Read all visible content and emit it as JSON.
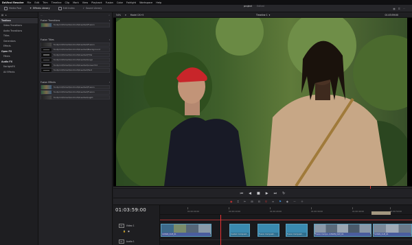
{
  "menubar": {
    "brand": "DaVinci Resolve",
    "items": [
      "File",
      "Edit",
      "Trim",
      "Timeline",
      "Clip",
      "Mark",
      "View",
      "Playback",
      "Fusion",
      "Color",
      "Fairlight",
      "Workspace",
      "Help"
    ]
  },
  "toolbar": {
    "media_pool": "Media Pool",
    "effects_library": "Effects Library",
    "edit_index": "Edit Index",
    "sound_library": "Sound Library",
    "project_title": "project",
    "edited": "Edited"
  },
  "left_panel": {
    "items": [
      {
        "label": "Toolbox",
        "group": true
      },
      {
        "label": "Video Transitions",
        "group": false
      },
      {
        "label": "Audio Transitions",
        "group": false
      },
      {
        "label": "Titles",
        "group": false
      },
      {
        "label": "Generators",
        "group": false
      },
      {
        "label": "Effects",
        "group": false
      },
      {
        "label": "Open FX",
        "group": true
      },
      {
        "label": "Filters",
        "group": false
      },
      {
        "label": "Audio FX",
        "group": true
      },
      {
        "label": "FairlightFX",
        "group": false
      },
      {
        "label": "AU Effects",
        "group": false
      }
    ]
  },
  "browser": {
    "sections": [
      {
        "title": "Fusion Transitions",
        "entries": [
          {
            "text": "footprint\\Smart\\Android\\Inserted\\Fusion",
            "thumb": "tv"
          }
        ]
      },
      {
        "title": "Fusion Titles",
        "entries": [
          {
            "text": "footprint\\Smart\\Android\\Inserted\\Fusion",
            "thumb": "gr"
          },
          {
            "text": "footprint\\Smart\\Android\\Inserted\\Background",
            "thumb": "dark"
          },
          {
            "text": "footprint\\Smart\\Android\\Inserted\\Title",
            "thumb": "dark"
          },
          {
            "text": "footprint\\Smart\\Android\\Inserted\\Logo",
            "thumb": "dark"
          },
          {
            "text": "footprint\\Smart\\Android\\Inserted\\Lower3rd",
            "thumb": "dark"
          },
          {
            "text": "footprint\\Smart\\Android\\Inserted\\Text",
            "thumb": "dark"
          }
        ]
      },
      {
        "title": "Fusion Effects",
        "entries": [
          {
            "text": "footprint\\Smart\\Android\\Inserted\\Fusion",
            "thumb": "tv"
          },
          {
            "text": "footprint\\Smart\\Android\\Inserted\\Fusion",
            "thumb": "tv"
          },
          {
            "text": "footprint\\Smart\\Android\\Inserted\\Light",
            "thumb": "gr"
          }
        ]
      }
    ]
  },
  "viewer": {
    "zoom": "54%",
    "clip_name": "Model DS+5",
    "timeline_name": "Timeline 1",
    "timecode": "01:03:59:00",
    "scrub_fraction": 0.86
  },
  "timeline": {
    "timecode": "01:03:59:00",
    "tracks": [
      {
        "id": "V1",
        "name": "Video 1"
      },
      {
        "id": "A1",
        "name": "Audio 1"
      }
    ],
    "ruler_ticks": [
      "01:00:00:00",
      "01:00:10:00",
      "01:00:20:00",
      "01:00:30:00",
      "01:00:40:00",
      "01:00:50:00"
    ],
    "clips": [
      {
        "label": "4.MAIN_CLIP_01",
        "type": "footage"
      },
      {
        "label": "Custom Composit...",
        "type": "transition"
      },
      {
        "label": "Fusion Composit...",
        "type": "transition"
      },
      {
        "label": "Fusion Composit...",
        "type": "transition"
      },
      {
        "label": "Fusion Compo...4.MAIN_CLIP_01",
        "type": "footage"
      },
      {
        "label": "4.MAIN_CLIP_01",
        "type": "footage"
      }
    ],
    "playhead_fraction": 0.24
  }
}
